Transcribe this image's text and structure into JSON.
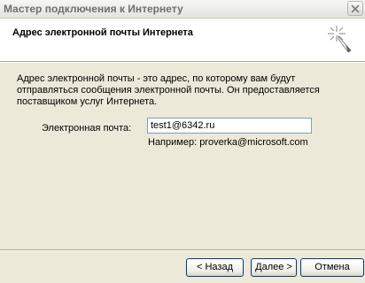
{
  "window": {
    "title": "Мастер подключения к Интернету"
  },
  "header": {
    "title": "Адрес электронной почты Интернета"
  },
  "body": {
    "description": "Адрес электронной почты - это адрес, по которому вам будут отправляться сообщения электронной почты. Он предоставляется поставщиком услуг Интернета.",
    "email_label": "Электронная почта:",
    "email_value": "test1@6342.ru",
    "example": "Например: proverka@microsoft.com"
  },
  "buttons": {
    "back": "< Назад",
    "next": "Далее >",
    "cancel": "Отмена"
  },
  "icons": {
    "close": "close-icon",
    "wizard": "wizard-sparkle-icon"
  }
}
